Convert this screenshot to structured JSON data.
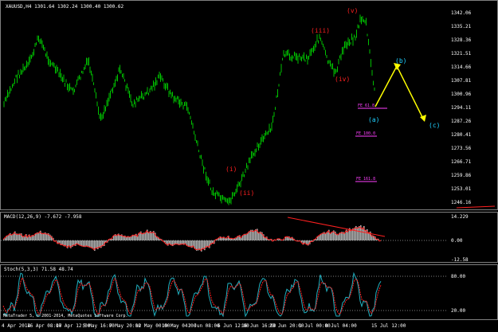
{
  "main": {
    "title": "XAUUSD,H4  1301.64 1302.24 1300.40 1300.62",
    "price_labels": [
      "1342.06",
      "1335.21",
      "1328.36",
      "1321.51",
      "1314.66",
      "1307.81",
      "1300.96",
      "1294.11",
      "1287.26",
      "1280.41",
      "1273.56",
      "1266.71",
      "1259.86",
      "1253.01",
      "1246.16"
    ],
    "waves": {
      "i": "(i)",
      "ii": "(ii)",
      "iii": "(iii)",
      "iv": "(iv)",
      "v": "(v)",
      "a": "(a)",
      "b": "(b)",
      "c": "(c)"
    },
    "fib": {
      "f1": "FE 61.8",
      "f2": "FE 100.0",
      "f3": "FE 161.8"
    },
    "colors": {
      "candle": "#00c000",
      "wave_red": "#ff2020",
      "wave_cyan": "#20d0ff",
      "projection": "#ffff00",
      "fib": "#ff40ff"
    }
  },
  "macd": {
    "title": "MACD(12,26,9) -7.672 -7.958",
    "labels": [
      "14.229",
      "0.00",
      "-12.58"
    ]
  },
  "stoch": {
    "title": "Stoch(5,3,3) 71.58 48.74",
    "labels": [
      "80.00",
      "20.00"
    ]
  },
  "footer": {
    "copyright": "MetaTrader 5, © 2001-2014, MetaQuotes Software Corp."
  },
  "xaxis": [
    "4 Apr 2014",
    "16 Apr 08:00",
    "17 Apr 12:00",
    "5 May 16:00",
    "7 May 20:00",
    "12 May 00:00",
    "19 May 04:00",
    "2 Jun 08:00",
    "6 Jun 12:00",
    "16 Jun 16:00",
    "23 Jun 20:00",
    "1 Jul 00:00",
    "8 Jul 04:00",
    "15 Jul 12:00"
  ]
}
